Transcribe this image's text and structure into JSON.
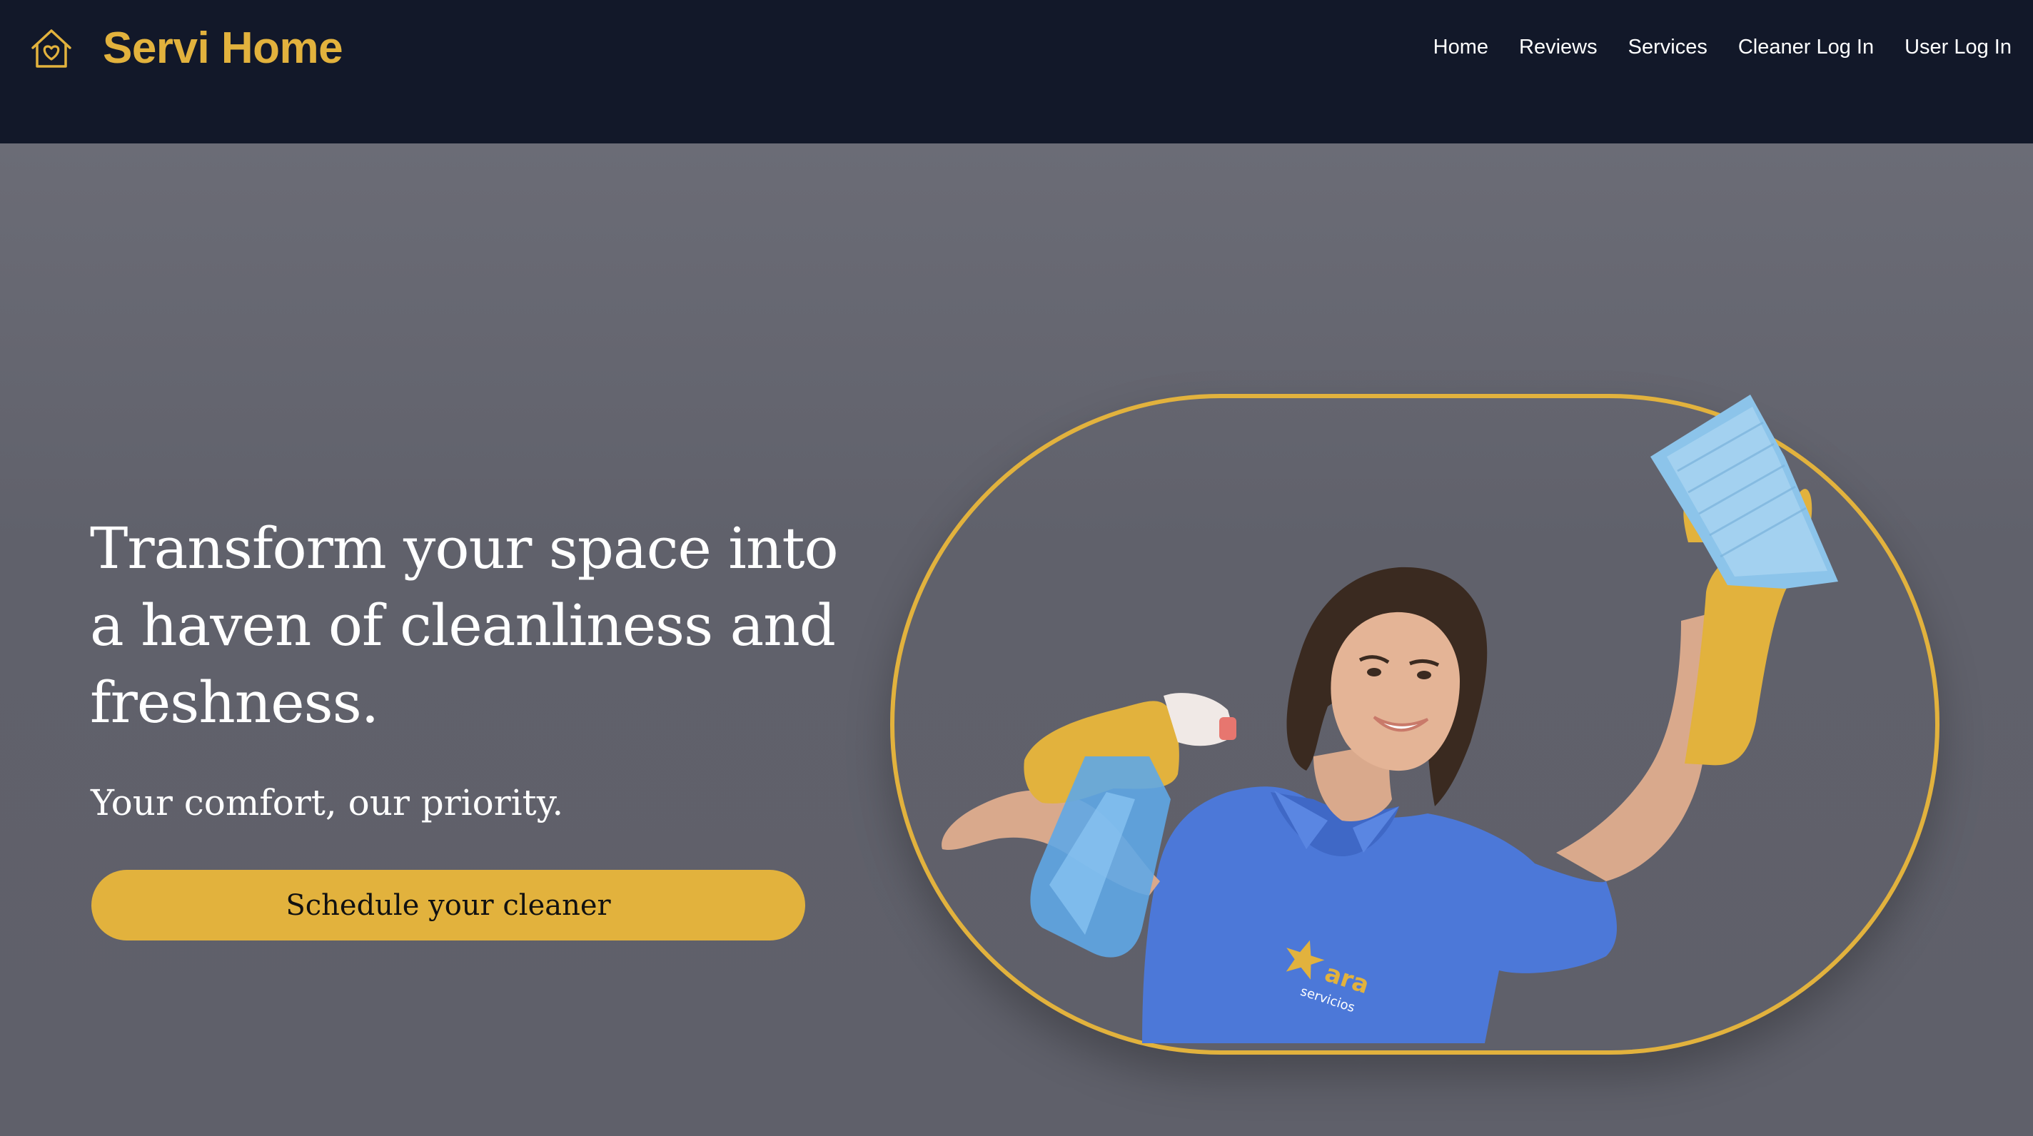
{
  "brand": {
    "name": "Servi Home",
    "icon": "home-heart-icon",
    "color": "#e2b23d"
  },
  "nav": {
    "items": [
      {
        "label": "Home"
      },
      {
        "label": "Reviews"
      },
      {
        "label": "Services"
      },
      {
        "label": "Cleaner Log In"
      },
      {
        "label": "User Log In"
      }
    ]
  },
  "hero": {
    "headline": "Transform your space into a haven of cleanliness and freshness.",
    "subheadline": "Your comfort, our priority.",
    "cta_label": "Schedule your cleaner",
    "image": {
      "subject": "smiling-cleaner-with-spray-bottle-and-cloth",
      "shirt_logo_text": "ara servicios"
    }
  },
  "colors": {
    "navbar_bg": "#121829",
    "hero_bg": "#626370",
    "accent": "#e2b23d",
    "text": "#ffffff"
  }
}
